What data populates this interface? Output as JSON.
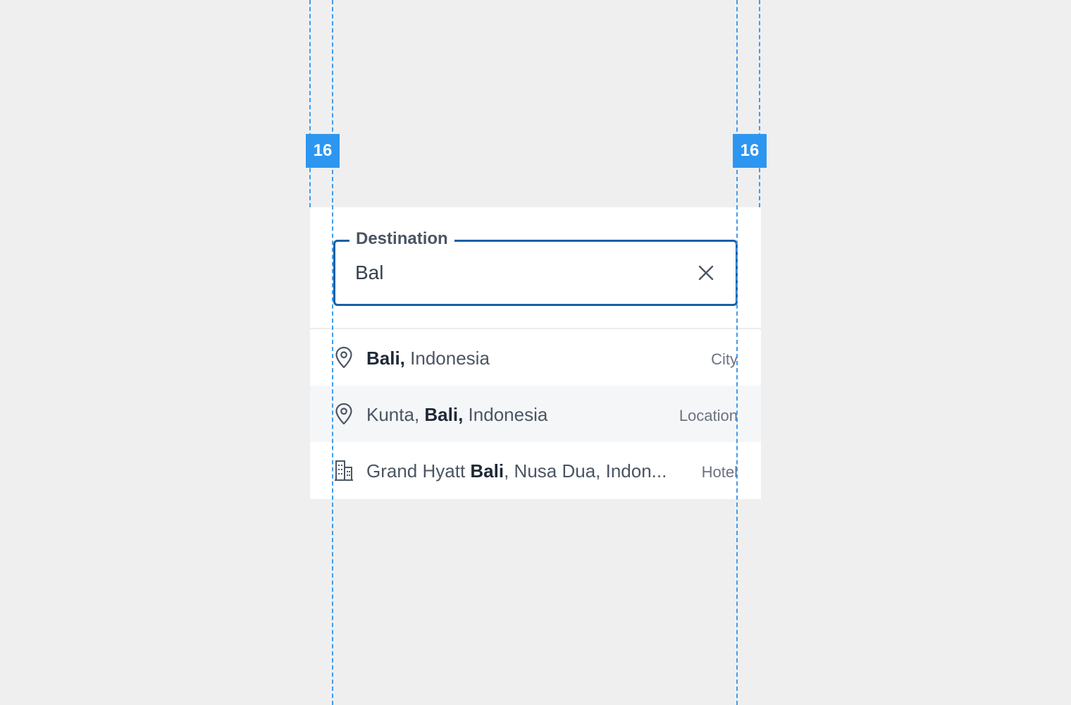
{
  "spacing_annotations": [
    {
      "label": "16"
    },
    {
      "label": "16"
    }
  ],
  "destination": {
    "label": "Destination",
    "value": "Bal",
    "clear_icon": "close-icon"
  },
  "suggestions": [
    {
      "icon": "location-pin-icon",
      "pre": "",
      "match": "Bali,",
      "post": " Indonesia",
      "type": "City",
      "highlighted": false
    },
    {
      "icon": "location-pin-icon",
      "pre": "Kunta, ",
      "match": "Bali,",
      "post": " Indonesia",
      "type": "Location",
      "highlighted": true
    },
    {
      "icon": "building-icon",
      "pre": "Grand Hyatt ",
      "match": "Bali",
      "post": ", Nusa Dua, Indon...",
      "type": "Hotel",
      "highlighted": false
    }
  ],
  "colors": {
    "guide": "#3d9df0",
    "badge": "#2d96f0",
    "field_border": "#1a5fa6",
    "row_highlight": "#f5f6f8"
  }
}
